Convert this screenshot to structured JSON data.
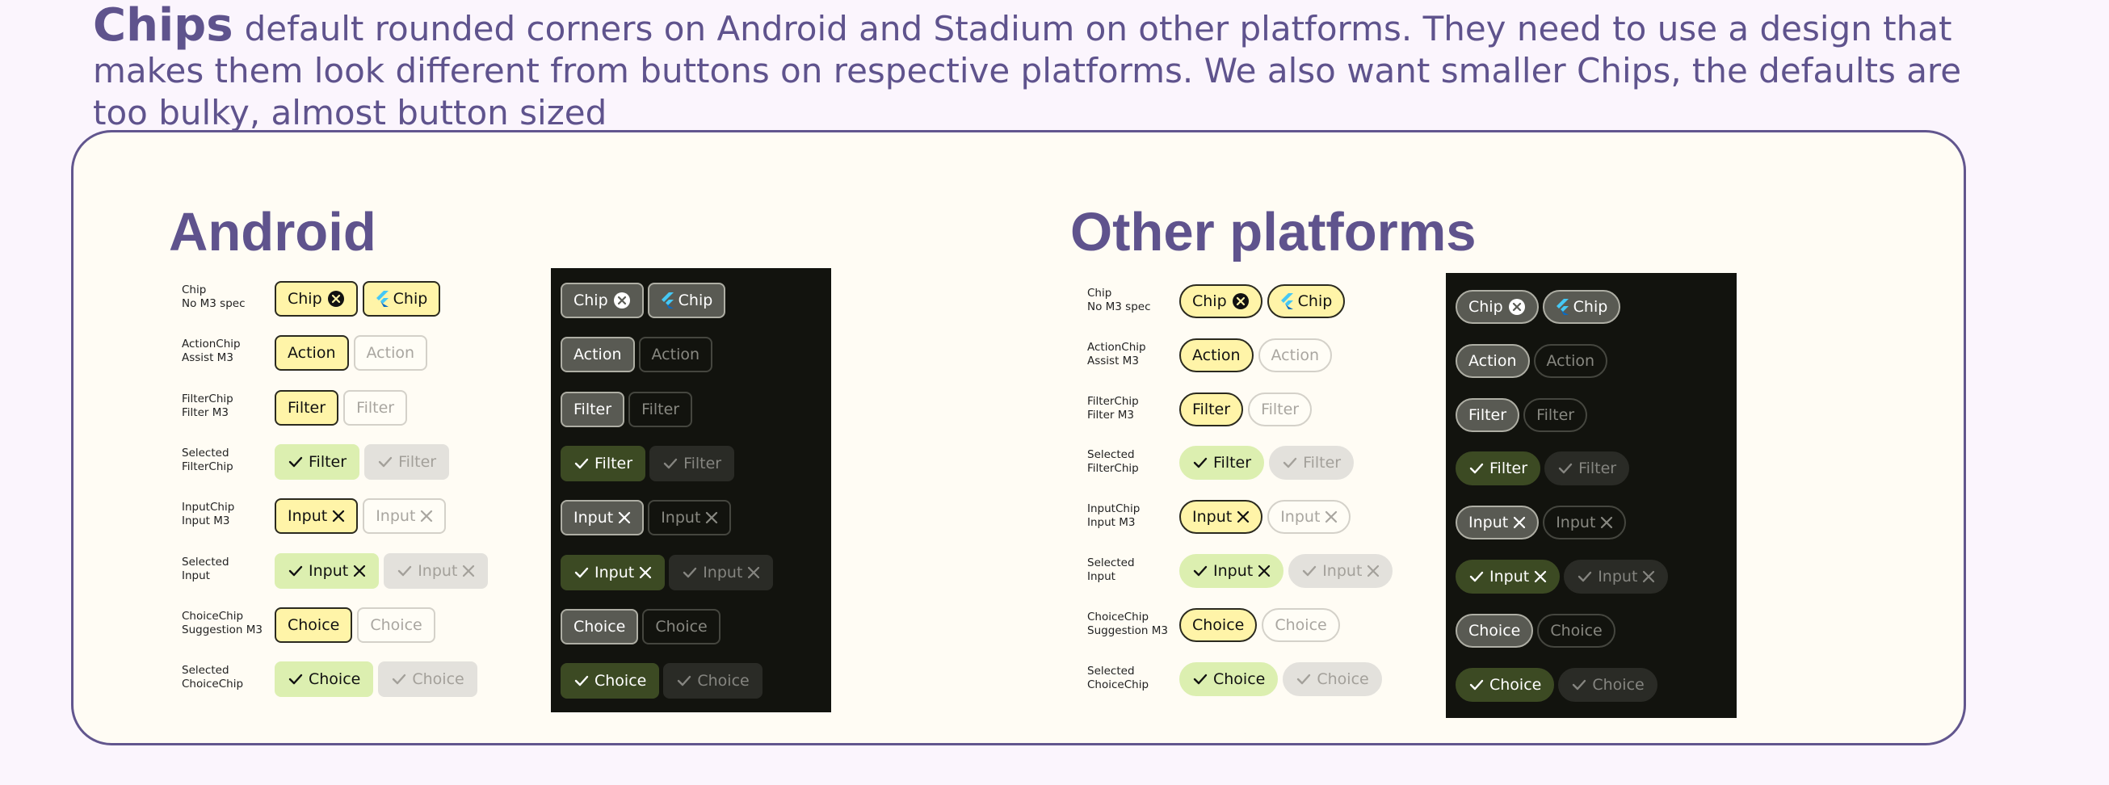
{
  "header": {
    "title": "Chips",
    "description": "default rounded corners on Android and Stadium on other platforms. They need to use a design that makes them look different from buttons on respective platforms. We also want smaller Chips, the defaults are too bulky, almost button sized"
  },
  "sections": {
    "android": {
      "title": "Android"
    },
    "other": {
      "title": "Other platforms"
    }
  },
  "rows": [
    {
      "label": "Chip\nNo M3 spec",
      "chips": [
        {
          "label": "Chip",
          "lead": "none",
          "trail": "xcircle",
          "style": "enabled"
        },
        {
          "label": "Chip",
          "lead": "flutter",
          "trail": "none",
          "style": "enabled"
        }
      ]
    },
    {
      "label": "ActionChip\nAssist M3",
      "chips": [
        {
          "label": "Action",
          "lead": "none",
          "trail": "none",
          "style": "enabled"
        },
        {
          "label": "Action",
          "lead": "none",
          "trail": "none",
          "style": "disabled"
        }
      ]
    },
    {
      "label": "FilterChip\nFilter M3",
      "chips": [
        {
          "label": "Filter",
          "lead": "none",
          "trail": "none",
          "style": "enabled"
        },
        {
          "label": "Filter",
          "lead": "none",
          "trail": "none",
          "style": "disabled"
        }
      ]
    },
    {
      "label": "Selected\nFilterChip",
      "chips": [
        {
          "label": "Filter",
          "lead": "check",
          "trail": "none",
          "style": "selected"
        },
        {
          "label": "Filter",
          "lead": "check",
          "trail": "none",
          "style": "selected-disabled"
        }
      ]
    },
    {
      "label": "InputChip\nInput M3",
      "chips": [
        {
          "label": "Input",
          "lead": "none",
          "trail": "x",
          "style": "enabled"
        },
        {
          "label": "Input",
          "lead": "none",
          "trail": "x",
          "style": "disabled"
        }
      ]
    },
    {
      "label": "Selected\nInput",
      "chips": [
        {
          "label": "Input",
          "lead": "check",
          "trail": "x",
          "style": "selected"
        },
        {
          "label": "Input",
          "lead": "check",
          "trail": "x",
          "style": "selected-disabled"
        }
      ]
    },
    {
      "label": "ChoiceChip\nSuggestion M3",
      "chips": [
        {
          "label": "Choice",
          "lead": "none",
          "trail": "none",
          "style": "enabled"
        },
        {
          "label": "Choice",
          "lead": "none",
          "trail": "none",
          "style": "disabled"
        }
      ]
    },
    {
      "label": "Selected\nChoiceChip",
      "chips": [
        {
          "label": "Choice",
          "lead": "check",
          "trail": "none",
          "style": "selected"
        },
        {
          "label": "Choice",
          "lead": "check",
          "trail": "none",
          "style": "selected-disabled"
        }
      ]
    }
  ],
  "colors": {
    "title": "#5f538d",
    "frame_border": "#62568e",
    "frame_bg": "#fffcf4",
    "page_bg": "#fbf5fd",
    "light": {
      "enabled": {
        "bg": "#fff4a8",
        "border": "#2b2a1f",
        "fg": "#111111"
      },
      "disabled": {
        "bg": "#fffdf6",
        "border": "#d4d1c9",
        "fg": "#a9a6a0"
      },
      "selected": {
        "bg": "#dcefb0",
        "border": "#dcefb0",
        "fg": "#111111"
      },
      "selected-disabled": {
        "bg": "#e3e1dc",
        "border": "#e3e1dc",
        "fg": "#a3a09a"
      }
    },
    "dark": {
      "panel": "#12130e",
      "enabled": {
        "bg": "#595a53",
        "border": "#aeaea4",
        "fg": "#ffffff"
      },
      "disabled": {
        "bg": "#12130e",
        "border": "#45463f",
        "fg": "#888881"
      },
      "selected": {
        "bg": "#3c4a23",
        "border": "#3c4a23",
        "fg": "#ffffff"
      },
      "selected-disabled": {
        "bg": "#2a2b26",
        "border": "#2a2b26",
        "fg": "#858580"
      }
    },
    "flutter_light_blue": "#45c8f5",
    "flutter_dark_blue": "#0a6bc2"
  }
}
